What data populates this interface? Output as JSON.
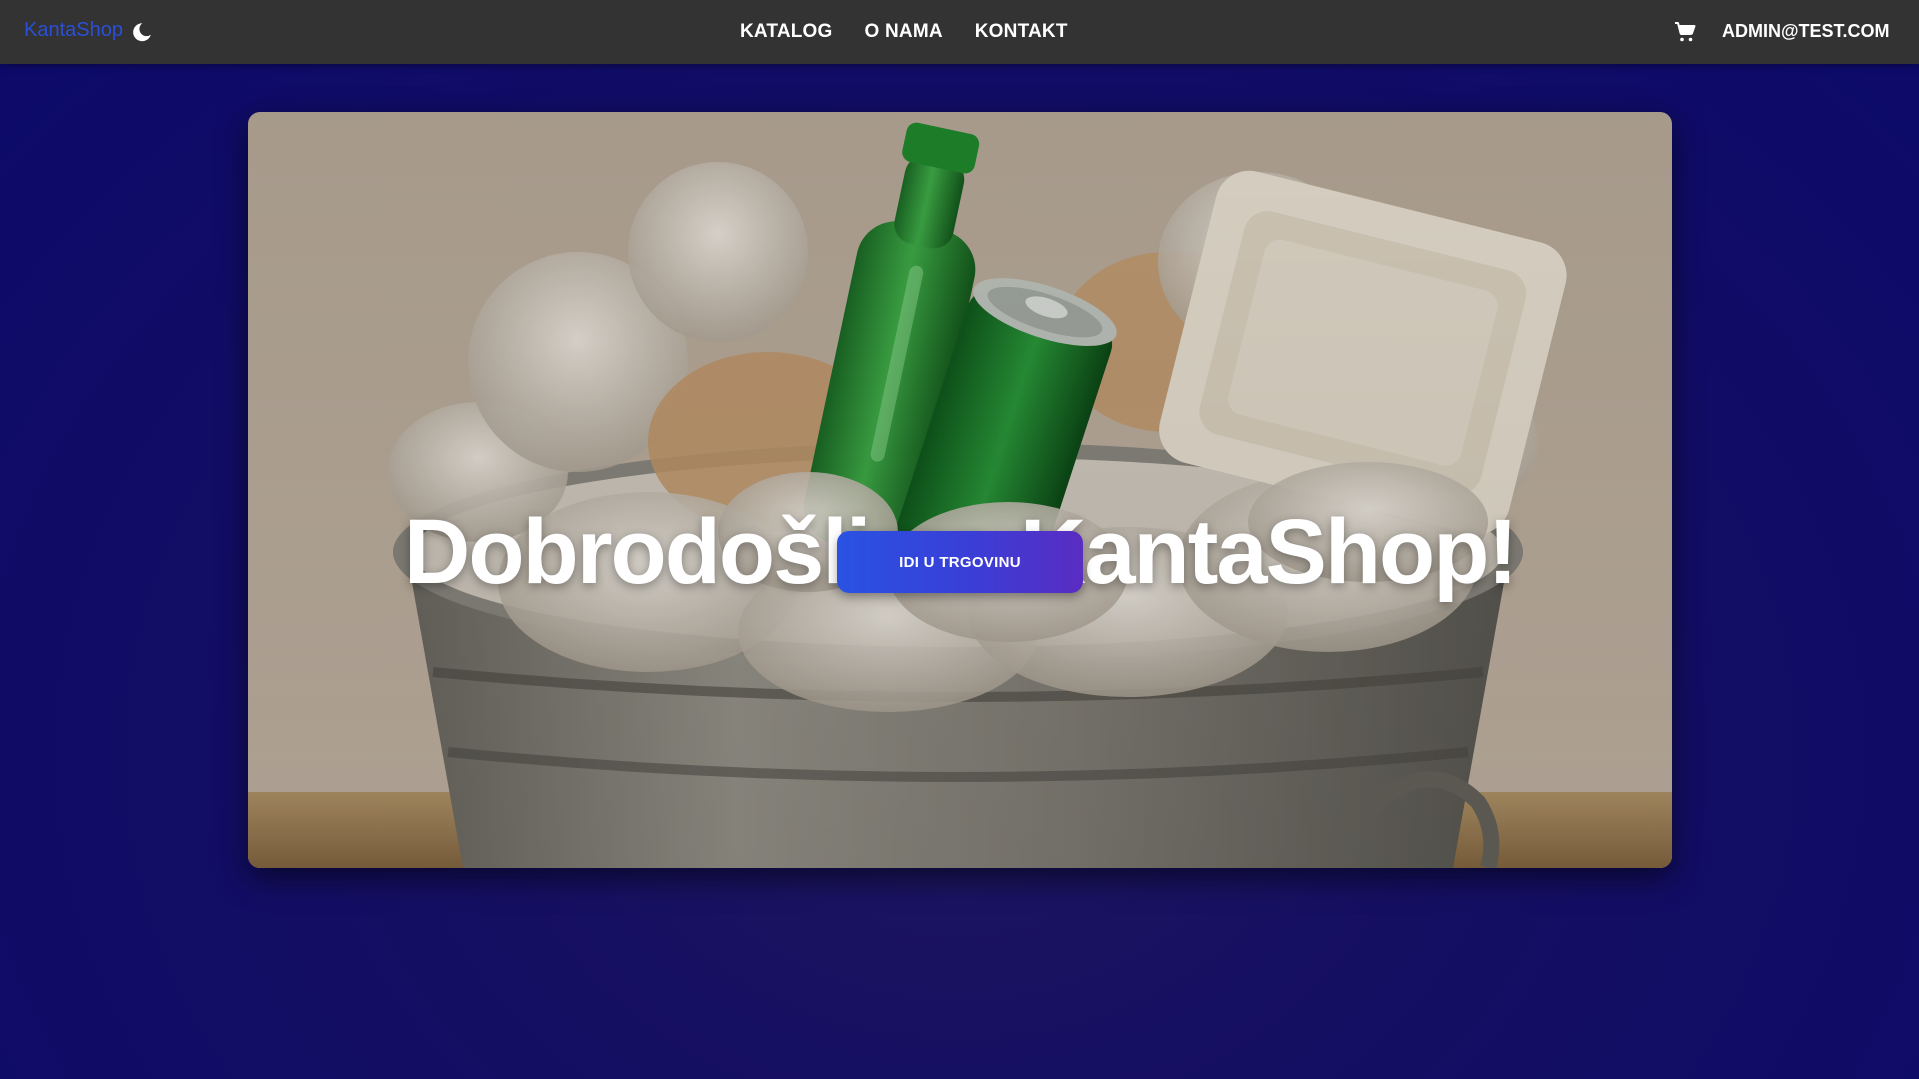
{
  "navbar": {
    "brand": "KantaShop",
    "theme_icon": "moon-icon",
    "links": [
      {
        "label": "KATALOG"
      },
      {
        "label": "O NAMA"
      },
      {
        "label": "KONTAKT"
      }
    ],
    "cart_icon": "cart-icon",
    "user_email": "ADMIN@TEST.COM"
  },
  "hero": {
    "title": "Dobrodošli na KantaShop!",
    "button_label": "IDI U TRGOVINU",
    "image": "trash-bin-illustration"
  },
  "colors": {
    "navbar_bg": "#333333",
    "brand": "#2b4fd6",
    "page_bg": "#0c0a6a",
    "button_start": "#2952e3",
    "button_end": "#5a2cc2"
  }
}
